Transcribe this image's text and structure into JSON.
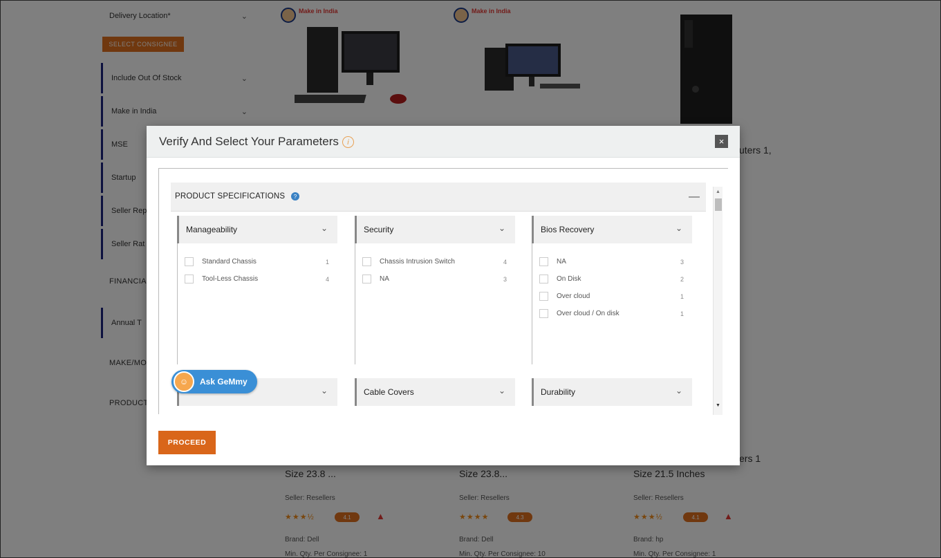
{
  "sidebar": {
    "delivery_location": "Delivery Location*",
    "select_consignee": "SELECT CONSIGNEE",
    "include_out_of_stock": "Include Out Of Stock",
    "make_in_india": "Make in India",
    "mse": "MSE",
    "startup": "Startup",
    "seller_rep": "Seller Rep",
    "seller_rat": "Seller Rat",
    "financial_heading": "FINANCIA",
    "annual_turnover": "Annual T",
    "make_model_heading": "MAKE/MO",
    "product_heading": "PRODUCT"
  },
  "products": [
    {
      "badge": "Make in India",
      "size": "Size 23.8 ...",
      "seller": "Seller: Resellers",
      "stars": "★★★½",
      "rating_badge": "4.1",
      "brand": "Brand: Dell",
      "moq": "Min. Qty. Per Consignee: 1"
    },
    {
      "badge": "Make in India",
      "size": "Size 23.8...",
      "seller": "Seller: Resellers",
      "stars": "★★★★",
      "rating_badge": "4.3",
      "brand": "Brand: Dell",
      "moq": "Min. Qty. Per Consignee: 10"
    },
    {
      "size": "Size 21.5 Inches",
      "seller": "Seller: Resellers",
      "stars": "★★★½",
      "rating_badge": "4.1",
      "brand": "Brand: hp",
      "moq": "Min. Qty. Per Consignee: 1"
    }
  ],
  "side_text": {
    "top": "uters 1,",
    "bottom": "ers 1"
  },
  "modal": {
    "title": "Verify And Select Your Parameters",
    "close": "×",
    "proceed": "PROCEED",
    "section": {
      "title": "PRODUCT SPECIFICATIONS",
      "collapse": "—"
    },
    "facets": [
      {
        "name": "Manageability",
        "options": [
          {
            "label": "Standard Chassis",
            "count": "1"
          },
          {
            "label": "Tool-Less Chassis",
            "count": "4"
          }
        ]
      },
      {
        "name": "Security",
        "options": [
          {
            "label": "Chassis Intrusion Switch",
            "count": "4"
          },
          {
            "label": "NA",
            "count": "3"
          }
        ]
      },
      {
        "name": "Bios Recovery",
        "options": [
          {
            "label": "NA",
            "count": "3"
          },
          {
            "label": "On Disk",
            "count": "2"
          },
          {
            "label": "Over cloud",
            "count": "1"
          },
          {
            "label": "Over cloud / On disk",
            "count": "1"
          }
        ]
      },
      {
        "name": ""
      },
      {
        "name": "Cable Covers"
      },
      {
        "name": "Durability"
      }
    ]
  },
  "assistant": {
    "label": "Ask GeMmy"
  },
  "colors": {
    "accent": "#d9661a",
    "assistant": "#3a8fd6"
  }
}
